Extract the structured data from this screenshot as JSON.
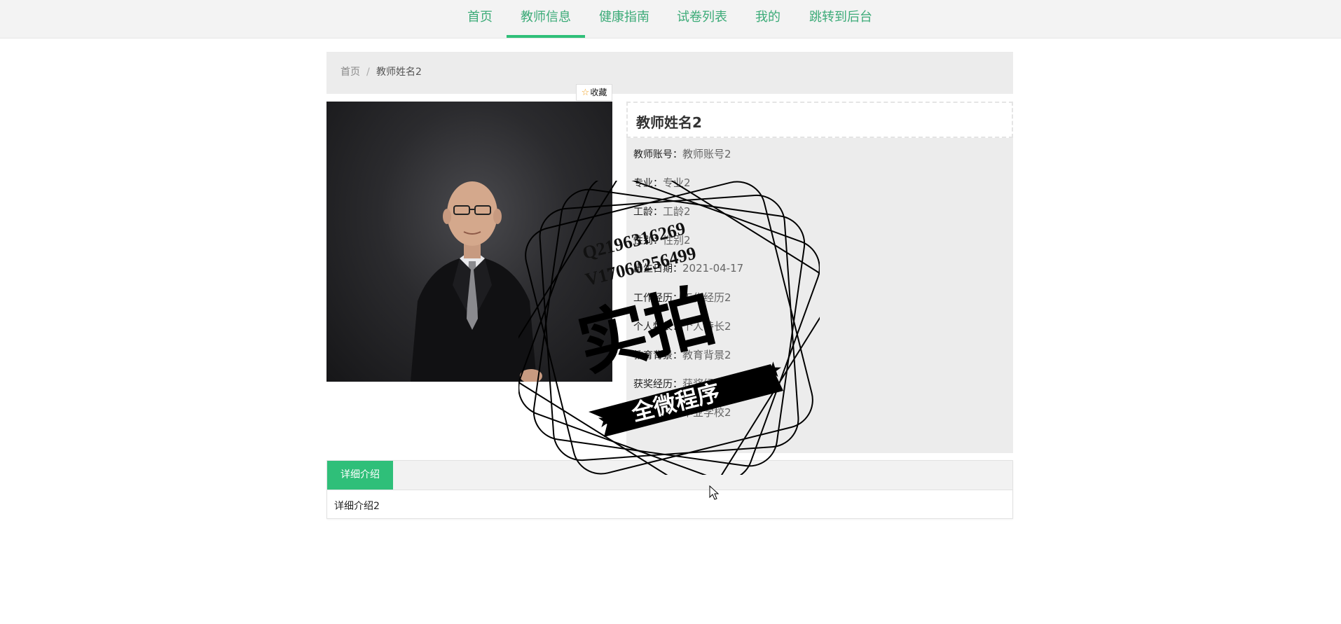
{
  "nav": {
    "items": [
      {
        "label": "首页"
      },
      {
        "label": "教师信息"
      },
      {
        "label": "健康指南"
      },
      {
        "label": "试卷列表"
      },
      {
        "label": "我的"
      },
      {
        "label": "跳转到后台"
      }
    ],
    "active_index": 1
  },
  "breadcrumb": {
    "home": "首页",
    "separator": "/",
    "current": "教师姓名2"
  },
  "favorite": {
    "label": "收藏",
    "icon": "star-icon"
  },
  "teacher": {
    "name": "教师姓名2",
    "fields": [
      {
        "key": "教师账号：",
        "value": "教师账号2"
      },
      {
        "key": "专业：",
        "value": "专业2"
      },
      {
        "key": "工龄：",
        "value": "工龄2"
      },
      {
        "key": "性别：",
        "value": "性别2"
      },
      {
        "key": "出生日期：",
        "value": "2021-04-17"
      },
      {
        "key": "工作经历：",
        "value": "工作经历2"
      },
      {
        "key": "个人特长：",
        "value": "个人特长2"
      },
      {
        "key": "教育背景：",
        "value": "教育背景2"
      },
      {
        "key": "获奖经历：",
        "value": "获奖经历2"
      },
      {
        "key": "毕业学校：",
        "value": "毕业学校2"
      }
    ]
  },
  "tabs": {
    "active_label": "详细介绍",
    "content": "详细介绍2"
  },
  "watermark": {
    "line1": "Q2196316269",
    "line2": "V17060256499",
    "main": "实拍",
    "banner": "全微程序"
  },
  "colors": {
    "accent": "#2fbf79",
    "nav_text": "#3cab78"
  }
}
